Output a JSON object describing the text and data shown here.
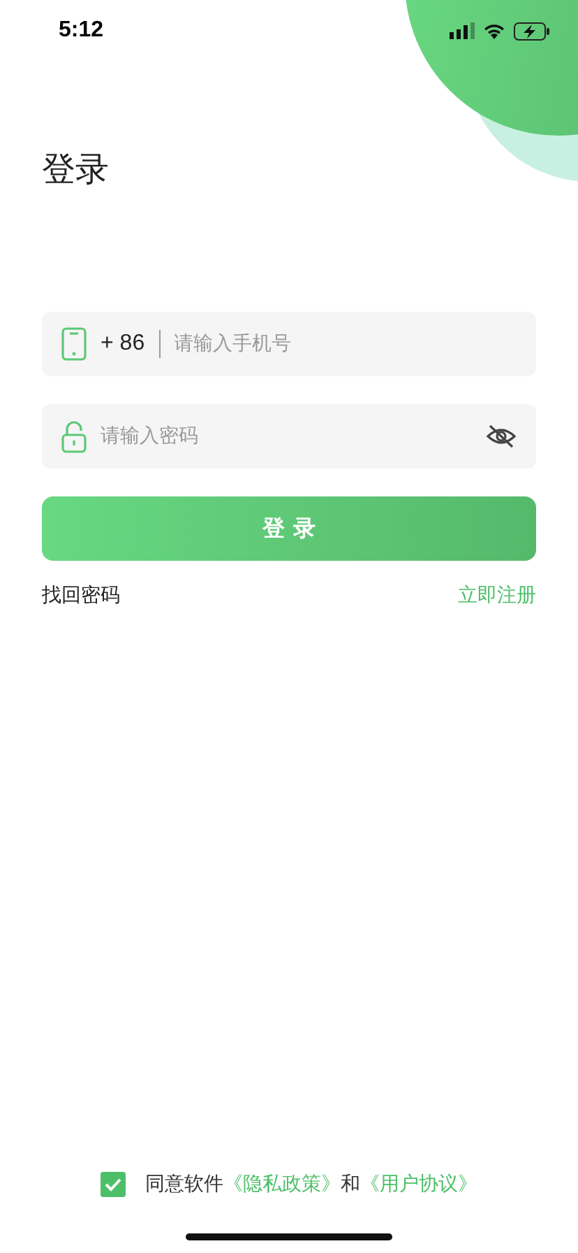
{
  "status_bar": {
    "time": "5:12"
  },
  "title": "登录",
  "phone_field": {
    "country_code": "+ 86",
    "placeholder": "请输入手机号"
  },
  "password_field": {
    "placeholder": "请输入密码",
    "password_visible": false
  },
  "login_button": "登 录",
  "links": {
    "forgot_password": "找回密码",
    "register": "立即注册"
  },
  "agreement": {
    "checked": true,
    "parts": [
      {
        "kind": "text",
        "text": "同意软件"
      },
      {
        "kind": "link",
        "text": "《隐私政策》"
      },
      {
        "kind": "text",
        "text": "和"
      },
      {
        "kind": "link",
        "text": "《用户协议》"
      }
    ]
  }
}
